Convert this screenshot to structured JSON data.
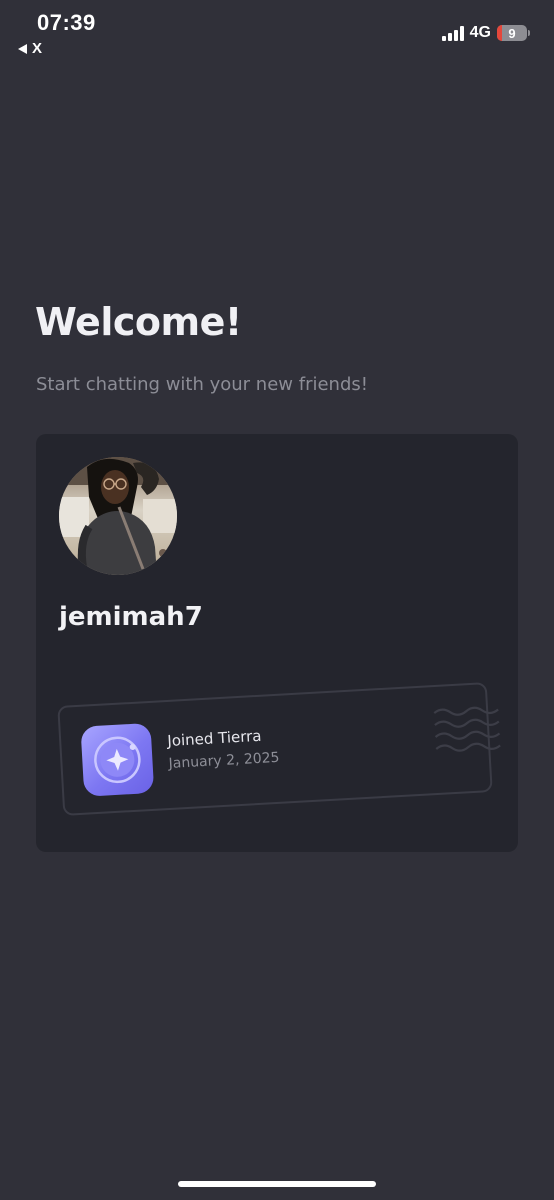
{
  "status_bar": {
    "time": "07:39",
    "back_app": "X",
    "network": "4G",
    "battery": "9",
    "battery_fraction": 0.09
  },
  "welcome": {
    "title": "Welcome!",
    "subtitle": "Start chatting with your new friends!"
  },
  "profile": {
    "username": "jemimah7",
    "avatar_icon": "profile-photo",
    "joined_title": "Joined Tierra",
    "joined_date": "January 2, 2025",
    "badge_icon": "planet-sparkle-icon"
  },
  "colors": {
    "background": "#303039",
    "card": "#24252d",
    "badge_accent": "#7d77f2",
    "subtitle": "#8c8d96"
  }
}
